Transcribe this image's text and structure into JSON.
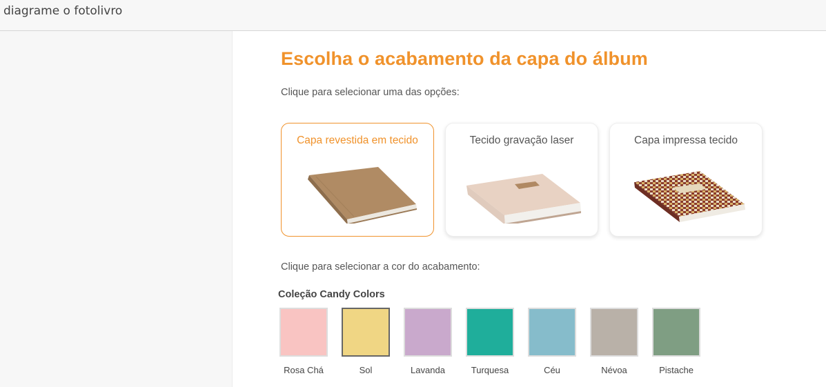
{
  "header": {
    "title": "diagrame o fotolivro"
  },
  "main": {
    "title": "Escolha o acabamento da capa do álbum",
    "finish_instruction": "Clique para selecionar uma das opções:",
    "color_instruction": "Clique para selecionar a cor do acabamento:",
    "finish_options": [
      {
        "label": "Capa revestida em tecido",
        "selected": true
      },
      {
        "label": "Tecido gravação laser",
        "selected": false
      },
      {
        "label": "Capa impressa tecido",
        "selected": false
      }
    ],
    "collection": {
      "title": "Coleção Candy Colors",
      "colors": [
        {
          "label": "Rosa Chá",
          "hex": "#f9c4c2",
          "selected": false
        },
        {
          "label": "Sol",
          "hex": "#f0d684",
          "selected": true
        },
        {
          "label": "Lavanda",
          "hex": "#c9a9cc",
          "selected": false
        },
        {
          "label": "Turquesa",
          "hex": "#1fae9b",
          "selected": false
        },
        {
          "label": "Céu",
          "hex": "#86bccb",
          "selected": false
        },
        {
          "label": "Névoa",
          "hex": "#b9b1a8",
          "selected": false
        },
        {
          "label": "Pistache",
          "hex": "#7f9e83",
          "selected": false
        }
      ]
    }
  }
}
